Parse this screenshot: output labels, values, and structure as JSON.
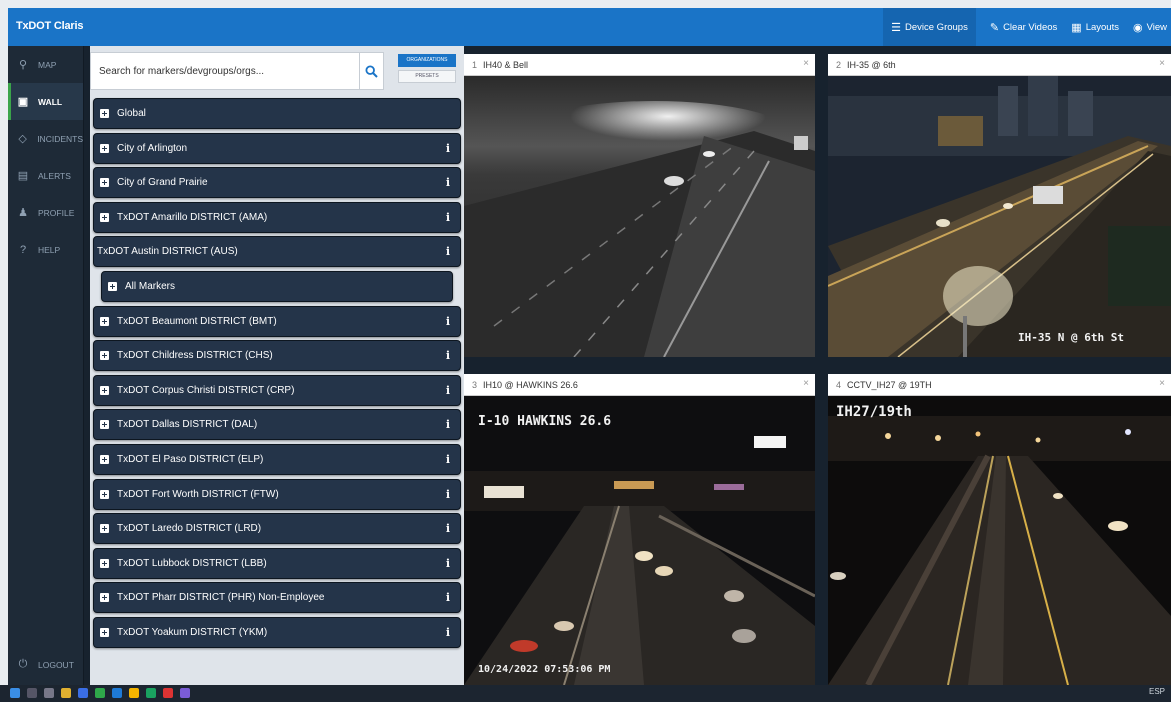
{
  "app": {
    "title": "TxDOT Claris"
  },
  "toolbar": [
    {
      "label": "Device Groups",
      "icon": "list-icon"
    },
    {
      "label": "Clear Videos",
      "icon": "eraser-icon"
    },
    {
      "label": "Layouts",
      "icon": "grid-icon"
    },
    {
      "label": "View",
      "icon": "eye-icon"
    }
  ],
  "nav": [
    {
      "label": "MAP",
      "icon": "map-marker-icon",
      "active": false
    },
    {
      "label": "WALL",
      "icon": "monitor-icon",
      "active": true
    },
    {
      "label": "INCIDENTS",
      "icon": "incident-icon",
      "active": false
    },
    {
      "label": "ALERTS",
      "icon": "alert-icon",
      "active": false
    },
    {
      "label": "PROFILE",
      "icon": "user-icon",
      "active": false
    },
    {
      "label": "HELP",
      "icon": "help-icon",
      "active": false
    }
  ],
  "logout": {
    "label": "LOGOUT",
    "icon": "power-icon"
  },
  "search": {
    "placeholder": "Search for markers/devgroups/orgs..."
  },
  "toggle": {
    "on": "ORGANIZATIONS",
    "off": "PRESETS"
  },
  "orgs": [
    {
      "label": "Global",
      "info": false
    },
    {
      "label": "City of Arlington",
      "info": true
    },
    {
      "label": "City of Grand Prairie",
      "info": true
    },
    {
      "label": "TxDOT Amarillo DISTRICT (AMA)",
      "info": true
    },
    {
      "label": "TxDOT Austin DISTRICT (AUS)",
      "info": true,
      "expanded": true
    },
    {
      "label": "All Markers",
      "info": false,
      "child": true
    },
    {
      "label": "TxDOT Beaumont DISTRICT (BMT)",
      "info": true
    },
    {
      "label": "TxDOT Childress DISTRICT (CHS)",
      "info": true
    },
    {
      "label": "TxDOT Corpus Christi DISTRICT (CRP)",
      "info": true
    },
    {
      "label": "TxDOT Dallas DISTRICT (DAL)",
      "info": true
    },
    {
      "label": "TxDOT El Paso DISTRICT (ELP)",
      "info": true
    },
    {
      "label": "TxDOT Fort Worth DISTRICT (FTW)",
      "info": true
    },
    {
      "label": "TxDOT Laredo DISTRICT (LRD)",
      "info": true
    },
    {
      "label": "TxDOT Lubbock DISTRICT (LBB)",
      "info": true
    },
    {
      "label": "TxDOT Pharr DISTRICT (PHR) Non-Employee",
      "info": true
    },
    {
      "label": "TxDOT Yoakum DISTRICT (YKM)",
      "info": true
    }
  ],
  "info_glyph": "i",
  "close_glyph": "×",
  "tiles": [
    {
      "index": "1",
      "title": "IH40 & Bell",
      "overlay": "",
      "timestamp": ""
    },
    {
      "index": "2",
      "title": "IH-35 @ 6th",
      "overlay": "IH-35 N @ 6th St",
      "timestamp": ""
    },
    {
      "index": "3",
      "title": "IH10 @ HAWKINS 26.6",
      "overlay": "I-10 HAWKINS 26.6",
      "timestamp": "10/24/2022 07:53:06 PM"
    },
    {
      "index": "4",
      "title": "CCTV_IH27 @ 19TH",
      "overlay": "IH27/19th",
      "timestamp": ""
    }
  ],
  "taskbar": {
    "tray_text": "ESP"
  },
  "colors": {
    "brand": "#1a74c7",
    "panel": "#243449",
    "active_nav": "#3aa44a"
  }
}
